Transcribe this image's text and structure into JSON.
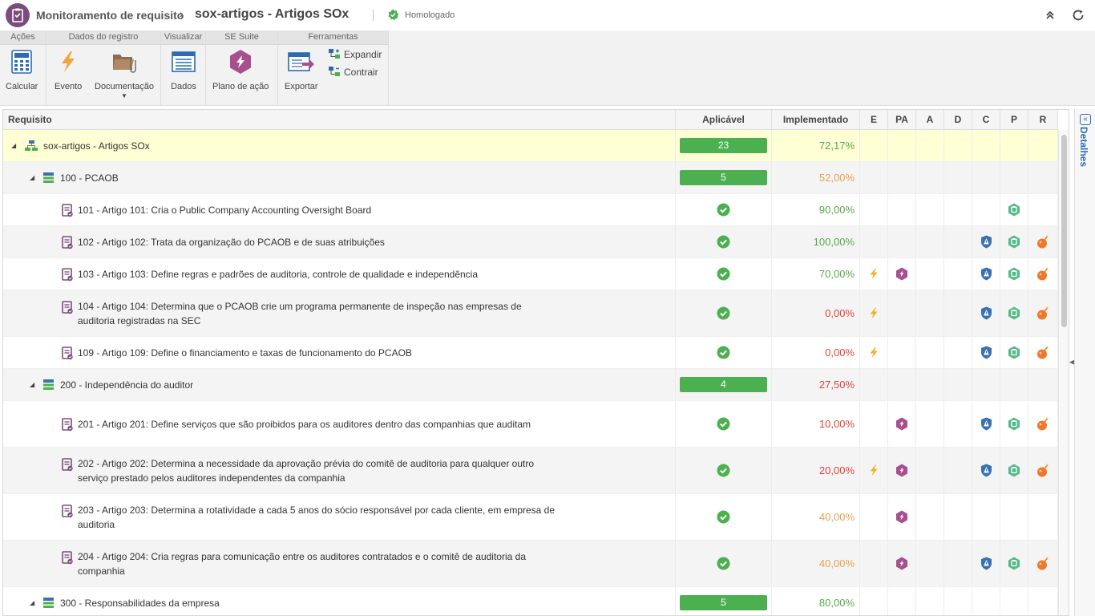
{
  "header": {
    "app_title": "Monitoramento de requisito",
    "record_title": "sox-artigos - Artigos SOx",
    "status": "Homologado"
  },
  "toolbar": {
    "groups": [
      {
        "label": "Ações"
      },
      {
        "label": "Dados do registro"
      },
      {
        "label": "Visualizar"
      },
      {
        "label": "SE Suite"
      },
      {
        "label": "Ferramentas"
      }
    ],
    "calcular": "Calcular",
    "evento": "Evento",
    "documentacao": "Documentação",
    "dados": "Dados",
    "plano": "Plano de ação",
    "exportar": "Exportar",
    "expandir": "Expandir",
    "contrair": "Contrair"
  },
  "grid": {
    "columns": [
      "Requisito",
      "Aplicável",
      "Implementado",
      "E",
      "PA",
      "A",
      "D",
      "C",
      "P",
      "R"
    ],
    "rows": [
      {
        "level": 0,
        "type": "root",
        "text": "sox-artigos - Artigos SOx",
        "aplicavel": "23",
        "implementado": "72,17%",
        "color": "g"
      },
      {
        "level": 1,
        "type": "group",
        "text": "100 - PCAOB",
        "aplicavel": "5",
        "implementado": "52,00%",
        "color": "o"
      },
      {
        "level": 2,
        "type": "req",
        "text": "101 - Artigo 101: Cria o Public Company Accounting Oversight Board",
        "implementado": "90,00%",
        "color": "g",
        "E": false,
        "PA": false,
        "C": false,
        "P": true,
        "R": false
      },
      {
        "level": 2,
        "type": "req",
        "text": "102 - Artigo 102: Trata da organização do PCAOB e de suas atribuições",
        "implementado": "100,00%",
        "color": "g",
        "E": false,
        "PA": false,
        "C": true,
        "P": true,
        "R": true
      },
      {
        "level": 2,
        "type": "req",
        "text": "103 - Artigo 103: Define regras e padrões de auditoria, controle de qualidade e independência",
        "implementado": "70,00%",
        "color": "g",
        "E": true,
        "PA": true,
        "C": true,
        "P": true,
        "R": true
      },
      {
        "level": 2,
        "type": "req",
        "text": "104 - Artigo 104: Determina que o PCAOB crie um programa permanente de inspeção nas empresas de auditoria registradas na SEC",
        "implementado": "0,00%",
        "color": "r",
        "E": true,
        "PA": false,
        "C": true,
        "P": true,
        "R": true
      },
      {
        "level": 2,
        "type": "req",
        "text": "109 - Artigo 109: Define o financiamento e taxas de funcionamento do PCAOB",
        "implementado": "0,00%",
        "color": "r",
        "E": true,
        "PA": false,
        "C": true,
        "P": true,
        "R": true
      },
      {
        "level": 1,
        "type": "group",
        "text": "200 - Independência do auditor",
        "aplicavel": "4",
        "implementado": "27,50%",
        "color": "r"
      },
      {
        "level": 2,
        "type": "req",
        "text": "201 - Artigo 201: Define serviços que são proibidos para os auditores dentro das companhias que auditam",
        "implementado": "10,00%",
        "color": "r",
        "E": false,
        "PA": true,
        "C": true,
        "P": true,
        "R": true
      },
      {
        "level": 2,
        "type": "req",
        "text": "202 - Artigo 202: Determina a necessidade da aprovação prévia do comitê de auditoria para qualquer outro serviço prestado pelos auditores independentes da companhia",
        "implementado": "20,00%",
        "color": "r",
        "E": true,
        "PA": true,
        "C": true,
        "P": true,
        "R": true
      },
      {
        "level": 2,
        "type": "req",
        "text": "203 - Artigo 203: Determina a rotatividade a cada 5 anos do sócio responsável por cada cliente, em empresa de auditoria",
        "implementado": "40,00%",
        "color": "o",
        "E": false,
        "PA": true,
        "C": false,
        "P": false,
        "R": false
      },
      {
        "level": 2,
        "type": "req",
        "text": "204 - Artigo 204: Cria regras para comunicação entre os auditores contratados e o comitê de auditoria da companhia",
        "implementado": "40,00%",
        "color": "o",
        "E": false,
        "PA": true,
        "C": true,
        "P": true,
        "R": true
      },
      {
        "level": 1,
        "type": "group",
        "text": "300 - Responsabilidades da empresa",
        "aplicavel": "5",
        "implementado": "80,00%",
        "color": "g"
      }
    ]
  },
  "side_panel": {
    "label": "Detalhes"
  },
  "colors": {
    "accent": "#2b6bb3",
    "success": "#4cb051",
    "brand": "#7b4b7f"
  }
}
